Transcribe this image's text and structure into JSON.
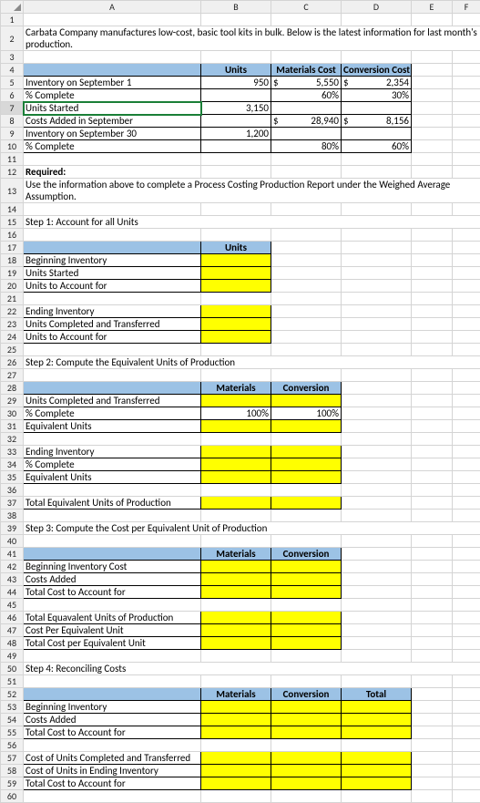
{
  "colHeaders": [
    "A",
    "B",
    "C",
    "D",
    "E",
    "F"
  ],
  "rowNumbers": [
    1,
    2,
    3,
    4,
    5,
    6,
    7,
    8,
    9,
    10,
    11,
    12,
    13,
    14,
    15,
    16,
    17,
    18,
    19,
    20,
    21,
    22,
    23,
    24,
    25,
    26,
    27,
    28,
    29,
    30,
    31,
    32,
    33,
    34,
    35,
    36,
    37,
    38,
    39,
    40,
    41,
    42,
    43,
    44,
    45,
    46,
    47,
    48,
    49,
    50,
    51,
    52,
    53,
    54,
    55,
    56,
    57,
    58,
    59,
    60
  ],
  "r2": "Carbata Company manufactures low-cost, basic tool kits in bulk. Below is the latest information for last month's production.",
  "h4": {
    "units": "Units",
    "mat": "Materials Cost",
    "conv": "Conversion Cost"
  },
  "r5": {
    "label": "Inventory on September 1",
    "B": "950",
    "C": "5,550",
    "D": "2,354"
  },
  "r6": {
    "label": "% Complete",
    "C": "60%",
    "D": "30%"
  },
  "r7": {
    "label": "Units Started",
    "B": "3,150"
  },
  "r8": {
    "label": "Costs Added in September",
    "C": "28,940",
    "D": "8,156"
  },
  "r9": {
    "label": "Inventory on September 30",
    "B": "1,200"
  },
  "r10": {
    "label": "% Complete",
    "C": "80%",
    "D": "60%"
  },
  "r12": "Required:",
  "r13": "Use the information above to complete a Process Costing Production Report under the Weighed Average Assumption.",
  "r15": "Step 1:  Account for all Units",
  "h17": {
    "units": "Units"
  },
  "r18": "Beginning Inventory",
  "r19": "Units Started",
  "r20": "Units to Account for",
  "r22": "Ending Inventory",
  "r23": "Units Completed and Transferred",
  "r24": "Units to Account for",
  "r26": "Step 2: Compute the Equivalent Units of Production",
  "h28": {
    "mat": "Materials",
    "conv": "Conversion"
  },
  "r29": "Units Completed and Transferred",
  "r30": {
    "label": "% Complete",
    "B": "100%",
    "C": "100%"
  },
  "r31": "Equivalent Units",
  "r33": "Ending Inventory",
  "r34": "% Complete",
  "r35": "Equivalent Units",
  "r37": "Total Equivalent Units of Production",
  "r39": "Step 3:  Compute the Cost per Equivalent Unit of Production",
  "h41": {
    "mat": "Materials",
    "conv": "Conversion"
  },
  "r42": "Beginning Inventory Cost",
  "r43": "Costs Added",
  "r44": "Total Cost to Account for",
  "r46": "Total Equavalent Units of Production",
  "r47": "Cost Per Equivalent Unit",
  "r48": "Total Cost per Equivalent Unit",
  "r50": "Step 4:  Reconciling Costs",
  "h52": {
    "mat": "Materials",
    "conv": "Conversion",
    "tot": "Total"
  },
  "r53": "Beginning Inventory",
  "r54": "Costs Added",
  "r55": "Total Cost to Account for",
  "r57": "Cost of Units Completed and Transferred",
  "r58": "Cost of Units in Ending Inventory",
  "r59": "Total Cost to Account for"
}
